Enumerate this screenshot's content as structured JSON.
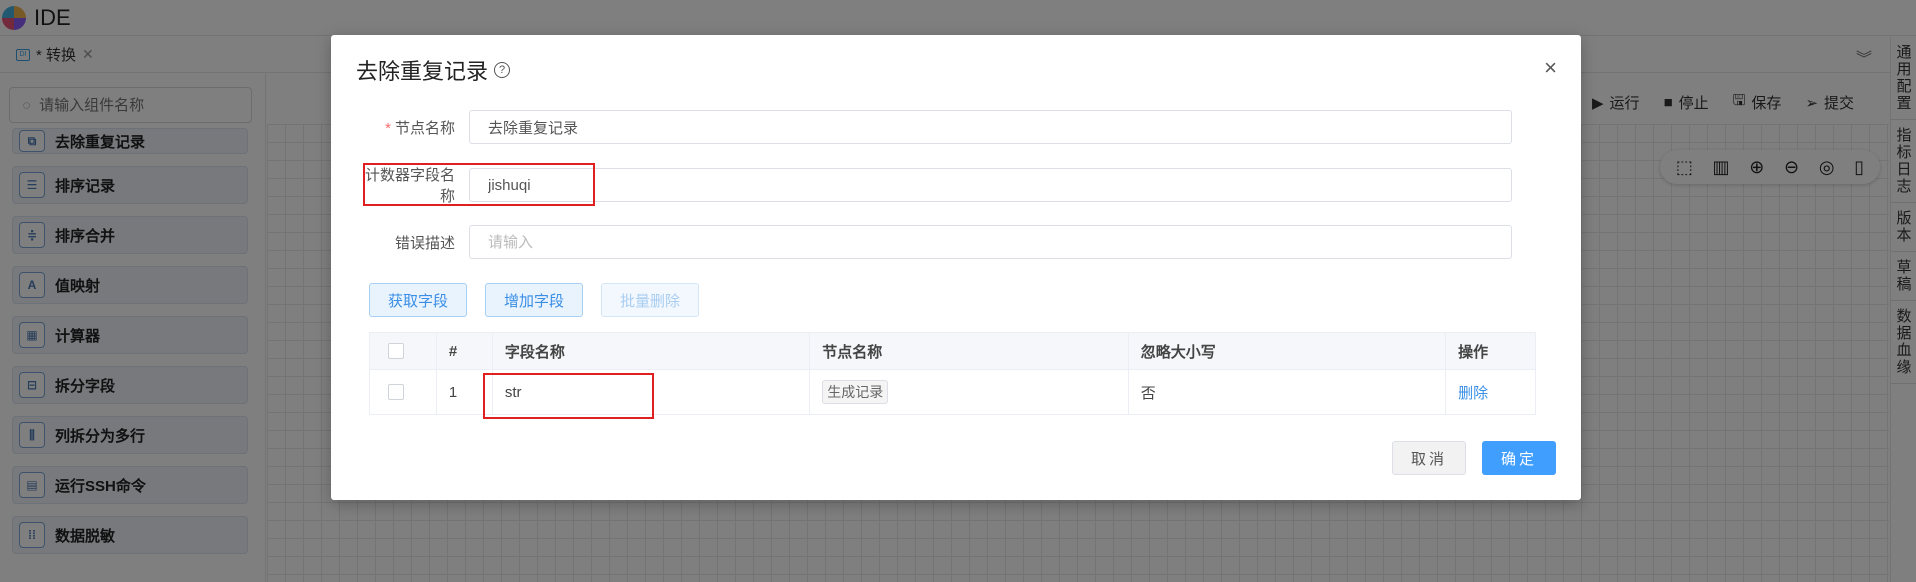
{
  "app": {
    "title": "IDE"
  },
  "tab": {
    "badge": "DI",
    "label": "* 转换",
    "close": "✕"
  },
  "sidebar": {
    "search_placeholder": "请输入组件名称",
    "items": [
      {
        "label": "去除重复记录",
        "icon": "dedupe-icon"
      },
      {
        "label": "排序记录",
        "icon": "sort-icon"
      },
      {
        "label": "排序合并",
        "icon": "merge-icon"
      },
      {
        "label": "值映射",
        "icon": "value-map-icon"
      },
      {
        "label": "计算器",
        "icon": "calculator-icon"
      },
      {
        "label": "拆分字段",
        "icon": "split-field-icon"
      },
      {
        "label": "列拆分为多行",
        "icon": "column-split-icon"
      },
      {
        "label": "运行SSH命令",
        "icon": "ssh-icon"
      },
      {
        "label": "数据脱敏",
        "icon": "mask-icon"
      }
    ]
  },
  "run_toolbar": {
    "run": "运行",
    "stop": "停止",
    "save": "保存",
    "submit": "提交"
  },
  "right_rail": [
    "通用配置",
    "指标日志",
    "版本",
    "草稿",
    "数据血缘"
  ],
  "modal": {
    "title": "去除重复记录",
    "fields": {
      "node_name": {
        "label": "节点名称",
        "value": "去除重复记录"
      },
      "counter_field": {
        "label": "计数器字段名称",
        "value": "jishuqi"
      },
      "error_desc": {
        "label": "错误描述",
        "value": "",
        "placeholder": "请输入"
      }
    },
    "buttons": {
      "get_fields": "获取字段",
      "add_field": "增加字段",
      "batch_delete": "批量删除"
    },
    "table": {
      "headers": {
        "index": "#",
        "field_name": "字段名称",
        "node_name": "节点名称",
        "ignore_case": "忽略大小写",
        "action": "操作"
      },
      "rows": [
        {
          "index": "1",
          "field_name": "str",
          "node_name": "生成记录",
          "ignore_case": "否",
          "action": "删除"
        }
      ]
    },
    "footer": {
      "cancel": "取消",
      "ok": "确定"
    }
  },
  "colors": {
    "primary": "#409eff",
    "highlight": "#e02020",
    "required": "#f56c6c"
  }
}
